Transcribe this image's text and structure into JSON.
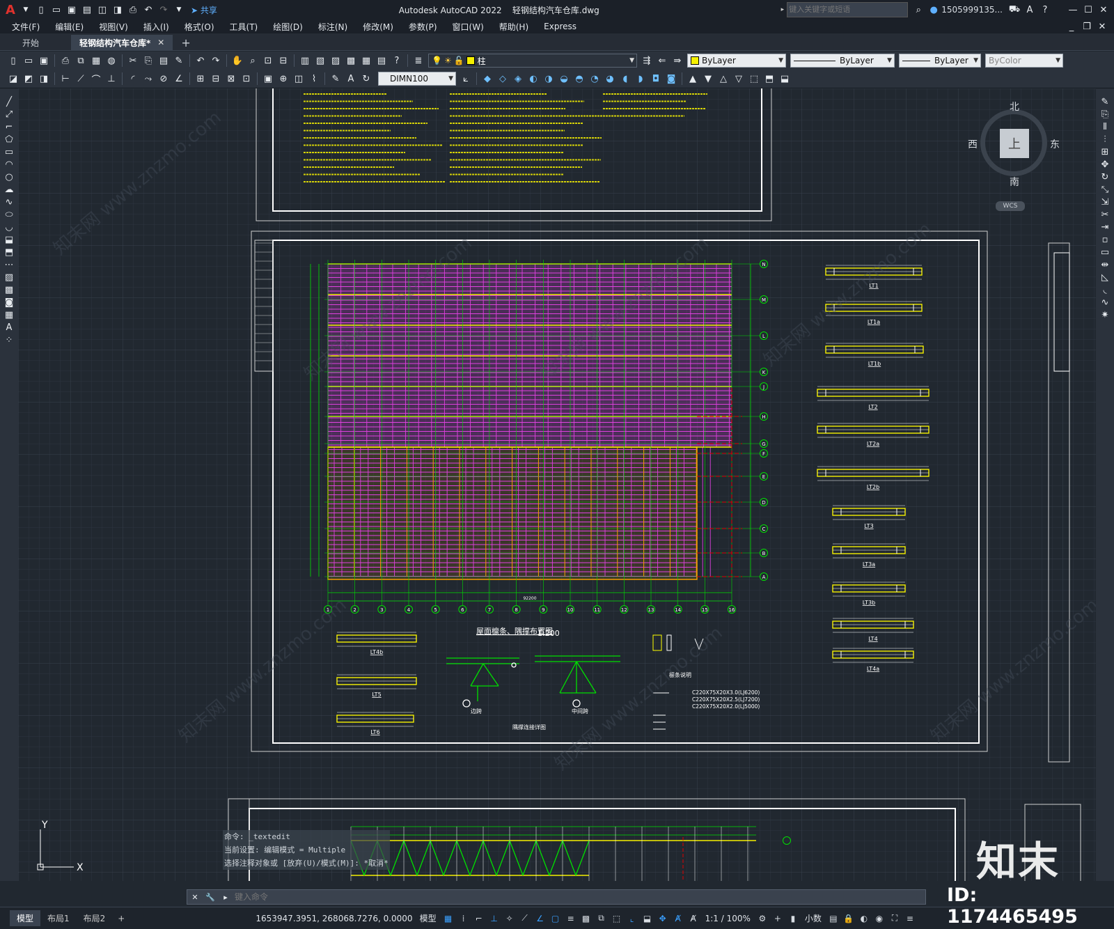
{
  "titlebar": {
    "app_title": "Autodesk AutoCAD 2022",
    "file_title": "轻钢结构汽车仓库.dwg",
    "share_label": "共享",
    "search_placeholder": "键入关键字或短语",
    "user": "1505999135...",
    "logo": "A"
  },
  "menus": [
    "文件(F)",
    "编辑(E)",
    "视图(V)",
    "插入(I)",
    "格式(O)",
    "工具(T)",
    "绘图(D)",
    "标注(N)",
    "修改(M)",
    "参数(P)",
    "窗口(W)",
    "帮助(H)",
    "Express"
  ],
  "tabs": [
    {
      "label": "开始"
    },
    {
      "label": "轻钢结构汽车仓库*"
    }
  ],
  "toolbar": {
    "layer_value": "柱",
    "color_value": "ByLayer",
    "linetype_value": "ByLayer",
    "lineweight_value": "ByLayer",
    "plotstyle_value": "ByColor",
    "dimstyle_value": "DIMN100"
  },
  "viewcube": {
    "north": "北",
    "south": "南",
    "east": "东",
    "west": "西",
    "top": "上",
    "wcs": "WCS"
  },
  "drawing": {
    "plan_title": "屋面檩条、隅撑布置图",
    "plan_scale": "1:200",
    "grid_letters": [
      "N",
      "M",
      "L",
      "K",
      "J",
      "H",
      "G",
      "F",
      "E",
      "D",
      "C",
      "B",
      "A"
    ],
    "grid_numbers": [
      "1",
      "2",
      "3",
      "4",
      "5",
      "6",
      "7",
      "8",
      "9",
      "10",
      "11",
      "12",
      "13",
      "14",
      "15",
      "16"
    ],
    "total_dim": "92200",
    "detail_labels": [
      "LT1",
      "LT1a",
      "LT1b",
      "LT2",
      "LT2a",
      "LT2b",
      "LT3",
      "LT3a",
      "LT3b",
      "LT4",
      "LT4a"
    ],
    "left_detail_labels": [
      "LT4b",
      "LT5",
      "LT6"
    ],
    "brace_title": "隅撑连接详图",
    "note_title": "檩条说明",
    "note_lines": [
      "C220X75X20X3.0(LJ6200)",
      "C220X75X20X2.5(LJ7200)",
      "C220X75X20X2.0(LJ5000)"
    ],
    "sub_labels": [
      "边跨",
      "中间跨"
    ],
    "watermark": "知末网 www.znzmo.com"
  },
  "command": {
    "history": [
      "命令:  _textedit",
      "当前设置: 编辑模式 = Multiple",
      "选择注释对象或 [放弃(U)/模式(M)]: *取消*"
    ],
    "input_placeholder": "键入命令"
  },
  "statusbar": {
    "coords": "1653947.3951, 268068.7276, 0.0000",
    "model_label": "模型",
    "scale": "1:1 / 100%",
    "units": "小数",
    "layout_tabs": [
      "模型",
      "布局1",
      "布局2"
    ]
  },
  "brand": {
    "logo_text": "知末",
    "id_text": "ID: 1174465495"
  },
  "colors": {
    "bg": "#212830",
    "magenta": "#e040e0",
    "yellow": "#f5f000",
    "green": "#00e000",
    "red": "#e00000",
    "white": "#ffffff",
    "orange": "#f5a000"
  }
}
